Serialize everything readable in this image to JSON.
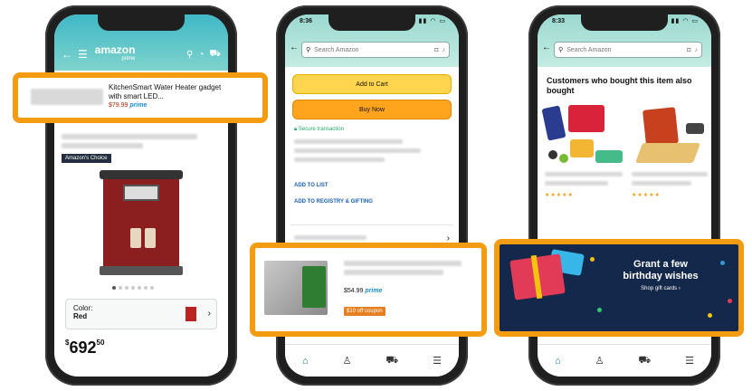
{
  "phone1": {
    "header": {
      "logo": "amazon",
      "logo_sub": "prime"
    },
    "highlight_product": {
      "title_line1": "KitchenSmart Water Heater gadget",
      "title_line2": "with smart LED...",
      "price": "$79.99",
      "prime": "prime"
    },
    "badge": "Amazon's Choice",
    "color_label": "Color:",
    "color_value": "Red",
    "price_dollars": "692",
    "price_cents": "50"
  },
  "phone2": {
    "status_time": "8:36",
    "search_placeholder": "Search Amazon",
    "add_to_cart": "Add to Cart",
    "buy_now": "Buy Now",
    "secure": "Secure transaction",
    "add_to_list": "ADD TO LIST",
    "add_to_registry": "ADD TO REGISTRY & GIFTING",
    "highlight_product": {
      "price": "$54.99",
      "prime": "prime",
      "coupon": "$10 off coupon"
    }
  },
  "phone3": {
    "status_time": "8:33",
    "search_placeholder": "Search Amazon",
    "section_title": "Customers who bought this item also bought",
    "banner": {
      "heading_line1": "Grant a few",
      "heading_line2": "birthday wishes",
      "sub": "Shop gift cards ›"
    }
  },
  "colors": {
    "highlight": "#f39c12",
    "amazon_teal": "#3fb8c6",
    "cart_yellow": "#ffd54f",
    "buy_orange": "#ffa41c",
    "banner_navy": "#13284a"
  }
}
